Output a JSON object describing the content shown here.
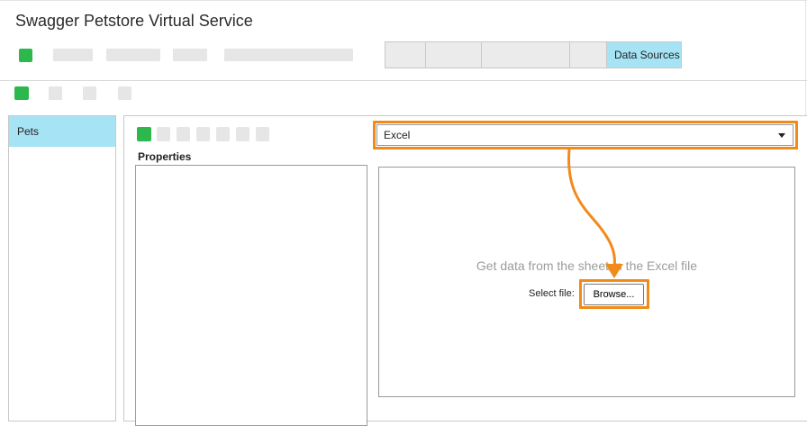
{
  "app": {
    "title": "Swagger Petstore Virtual Service"
  },
  "tabs": {
    "active_label": "Data Sources"
  },
  "sidebar": {
    "items": [
      {
        "label": "Pets"
      }
    ]
  },
  "properties": {
    "label": "Properties"
  },
  "datasource": {
    "selected": "Excel",
    "hint": "Get data from the sheet in the Excel file",
    "select_file_label": "Select file:",
    "browse_label": "Browse..."
  },
  "colors": {
    "accent": "#2db84d",
    "selection": "#a6e3f5",
    "highlight": "#f28a1a"
  }
}
